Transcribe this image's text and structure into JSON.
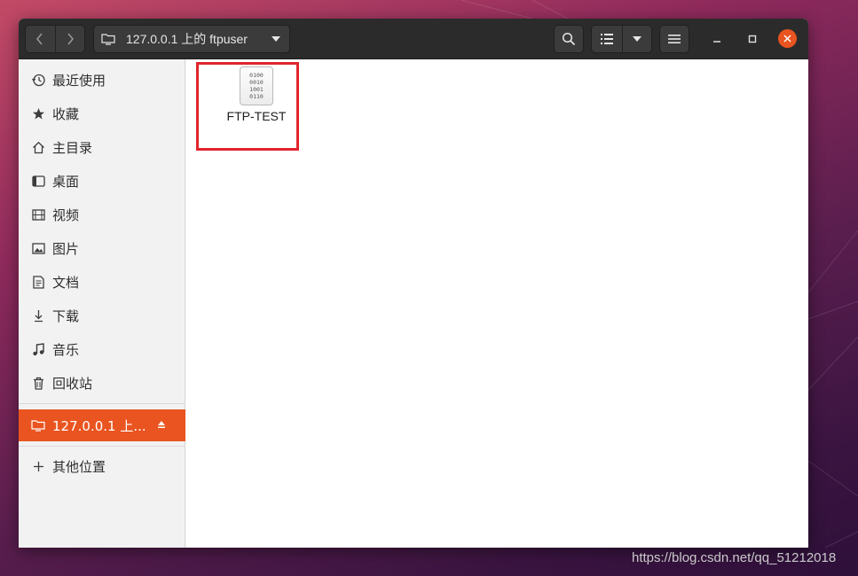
{
  "window": {
    "location_label": "127.0.0.1 上的 ftpuser"
  },
  "sidebar": {
    "items": [
      {
        "label": "最近使用",
        "icon": "clock-icon"
      },
      {
        "label": "收藏",
        "icon": "star-icon"
      },
      {
        "label": "主目录",
        "icon": "home-icon"
      },
      {
        "label": "桌面",
        "icon": "desktop-icon"
      },
      {
        "label": "视频",
        "icon": "film-icon"
      },
      {
        "label": "图片",
        "icon": "image-icon"
      },
      {
        "label": "文档",
        "icon": "document-icon"
      },
      {
        "label": "下载",
        "icon": "download-icon"
      },
      {
        "label": "音乐",
        "icon": "music-icon"
      },
      {
        "label": "回收站",
        "icon": "trash-icon"
      }
    ],
    "mounted": {
      "label": "127.0.0.1 上...",
      "icon": "remote-folder-icon",
      "active": true
    },
    "other": {
      "label": "其他位置",
      "icon": "plus-icon"
    }
  },
  "content": {
    "files": [
      {
        "name": "FTP-TEST",
        "icon": "binary-file-icon",
        "binary_glyph": "0100\n0010\n1001\n0110"
      }
    ]
  },
  "watermark": "https://blog.csdn.net/qq_51212018",
  "colors": {
    "accent": "#e95420",
    "highlight_box": "#e0242c",
    "headerbar": "#2b2b2b"
  }
}
